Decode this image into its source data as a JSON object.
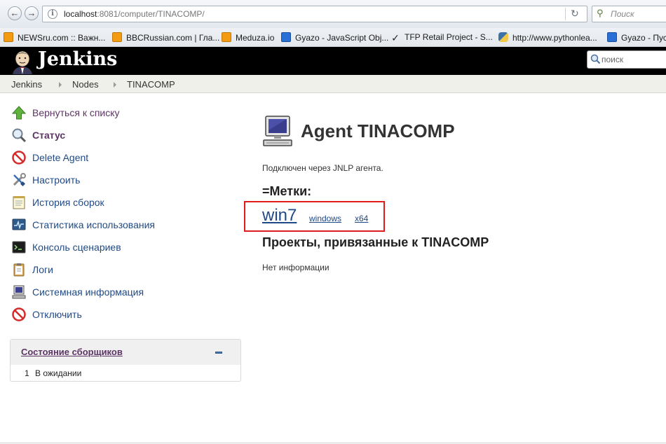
{
  "browser": {
    "url_host": "localhost",
    "url_rest": ":8081/computer/TINACOMP/",
    "search_placeholder": "Поиск",
    "bookmarks": [
      {
        "label": "NEWSru.com :: Важн...",
        "icon": "rss-icon"
      },
      {
        "label": "BBCRussian.com | Гла...",
        "icon": "rss-icon"
      },
      {
        "label": "Meduza.io",
        "icon": "rss-icon"
      },
      {
        "label": "Gyazo - JavaScript Obj...",
        "icon": "gyazo-icon"
      },
      {
        "label": "TFP Retail Project - S...",
        "icon": "checkmark-icon"
      },
      {
        "label": "http://www.pythonlea...",
        "icon": "python-icon"
      },
      {
        "label": "Gyazo - Пус",
        "icon": "gyazo-icon"
      }
    ]
  },
  "header": {
    "brand": "Jenkins",
    "search_placeholder": "поиск"
  },
  "breadcrumb": [
    "Jenkins",
    "Nodes",
    "TINACOMP"
  ],
  "sidebar": {
    "items": [
      {
        "label": "Вернуться к списку",
        "icon": "up-arrow-icon"
      },
      {
        "label": "Статус",
        "icon": "magnifier-icon",
        "current": true
      },
      {
        "label": "Delete Agent",
        "icon": "no-entry-icon"
      },
      {
        "label": "Настроить",
        "icon": "wrench-screwdriver-icon"
      },
      {
        "label": "История сборок",
        "icon": "notepad-icon"
      },
      {
        "label": "Статистика использования",
        "icon": "monitor-graph-icon"
      },
      {
        "label": "Консоль сценариев",
        "icon": "terminal-icon"
      },
      {
        "label": "Логи",
        "icon": "clipboard-icon"
      },
      {
        "label": "Системная информация",
        "icon": "computer-icon"
      },
      {
        "label": "Отключить",
        "icon": "no-entry-icon"
      }
    ]
  },
  "executors": {
    "title": "Состояние сборщиков",
    "rows": [
      {
        "number": "1",
        "status": "В ожидании"
      }
    ]
  },
  "main": {
    "title": "Agent TINACOMP",
    "connected_text": "Подключен через JNLP агента.",
    "labels_heading": "=Метки:",
    "labels": [
      "win7",
      "windows",
      "x64"
    ],
    "projects_heading": "Проекты, привязанные к TINACOMP",
    "no_info": "Нет информации"
  },
  "colors": {
    "header_bg": "#000000",
    "link": "#204a87",
    "visited": "#5c3566",
    "highlight_box": "#e01b1b"
  }
}
